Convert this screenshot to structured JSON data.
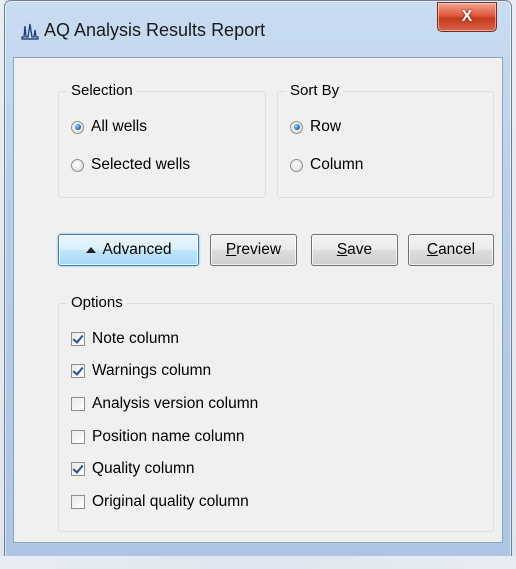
{
  "window": {
    "title": "AQ Analysis Results Report",
    "close_glyph": "X",
    "icon": "waveform-icon"
  },
  "selection": {
    "legend": "Selection",
    "options": [
      {
        "label": "All wells",
        "checked": true
      },
      {
        "label": "Selected wells",
        "checked": false
      }
    ]
  },
  "sort_by": {
    "legend": "Sort By",
    "options": [
      {
        "label": "Row",
        "checked": true
      },
      {
        "label": "Column",
        "checked": false
      }
    ]
  },
  "buttons": {
    "advanced": "Advanced",
    "preview_mnemonic": "P",
    "preview_rest": "review",
    "save_mnemonic": "S",
    "save_rest": "ave",
    "cancel_mnemonic": "C",
    "cancel_rest": "ancel"
  },
  "options": {
    "legend": "Options",
    "items": [
      {
        "label": "Note column",
        "checked": true
      },
      {
        "label": "Warnings column",
        "checked": true
      },
      {
        "label": "Analysis version column",
        "checked": false
      },
      {
        "label": "Position name column",
        "checked": false
      },
      {
        "label": "Quality column",
        "checked": true
      },
      {
        "label": "Original quality column",
        "checked": false
      }
    ]
  },
  "colors": {
    "default_button_border": "#3c7fb1",
    "close_button": "#c43b1e",
    "window_frame": "#b7cde8"
  }
}
